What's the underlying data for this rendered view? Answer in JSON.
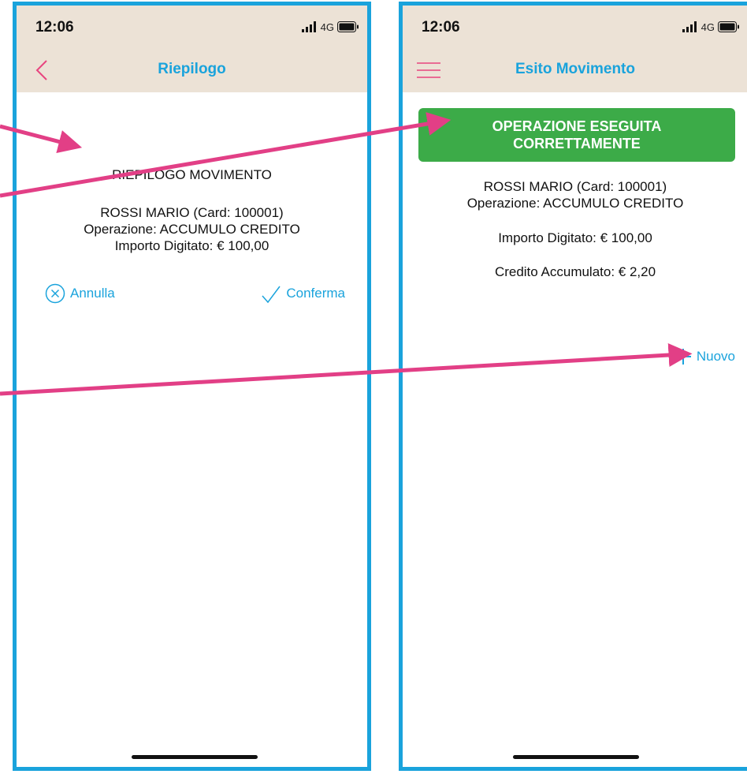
{
  "status": {
    "time": "12:06",
    "network": "4G"
  },
  "left": {
    "title": "Riepilogo",
    "heading": "RIEPILOGO MOVIMENTO",
    "customer": "ROSSI MARIO (Card: 100001)",
    "operation": "Operazione: ACCUMULO CREDITO",
    "amount": "Importo Digitato: € 100,00",
    "cancel_label": "Annulla",
    "confirm_label": "Conferma"
  },
  "right": {
    "title": "Esito Movimento",
    "banner_line1": "OPERAZIONE ESEGUITA",
    "banner_line2": "CORRETTAMENTE",
    "customer": "ROSSI MARIO (Card: 100001)",
    "operation": "Operazione: ACCUMULO CREDITO",
    "amount": "Importo Digitato: € 100,00",
    "credit": "Credito Accumulato: € 2,20",
    "new_label": "Nuovo"
  },
  "colors": {
    "accent": "#1aa3dc",
    "back": "#e8457f",
    "success": "#3cab48",
    "annotation_arrow": "#e23f86",
    "bar": "#ece2d6"
  }
}
